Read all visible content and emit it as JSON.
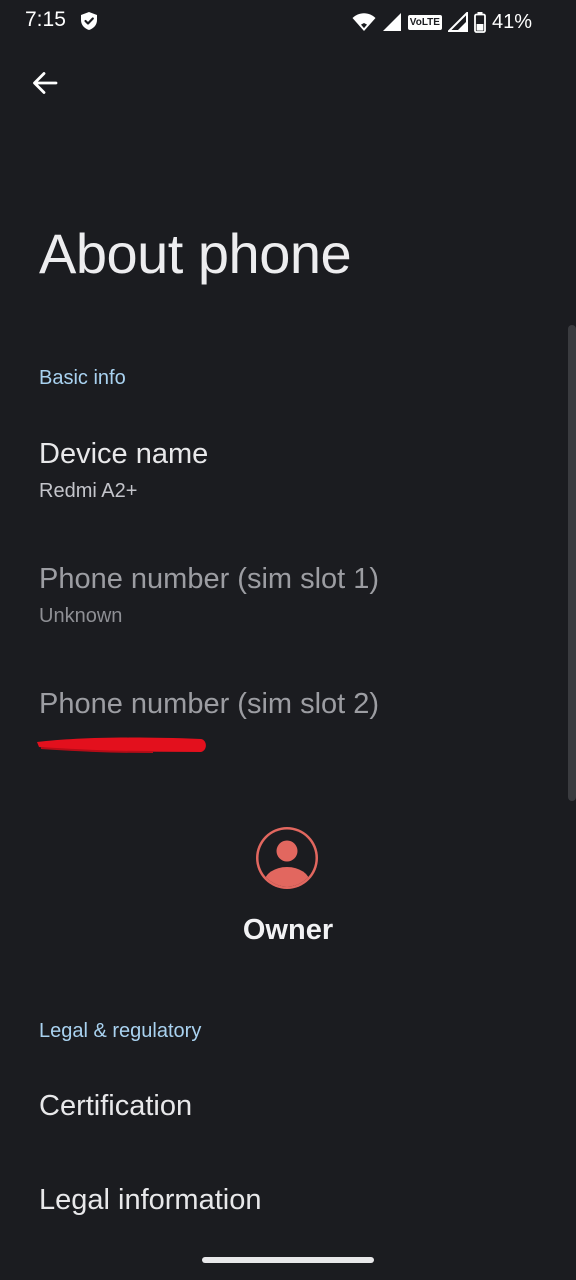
{
  "status_bar": {
    "time": "7:15",
    "network_label": "VoLTE",
    "battery_percent": "41%"
  },
  "header": {
    "title": "About phone"
  },
  "sections": {
    "basic_info": "Basic info",
    "legal": "Legal & regulatory"
  },
  "items": {
    "device_name": {
      "title": "Device name",
      "summary": "Redmi A2+"
    },
    "phone_sim1": {
      "title": "Phone number (sim slot 1)",
      "summary": "Unknown"
    },
    "phone_sim2": {
      "title": "Phone number (sim slot 2)",
      "summary": ""
    },
    "certification": {
      "title": "Certification"
    },
    "legal_information": {
      "title": "Legal information"
    }
  },
  "owner": {
    "label": "Owner"
  },
  "colors": {
    "background": "#1b1c20",
    "section_header": "#a9d2f0",
    "avatar": "#e2675f",
    "redaction": "#e3101d"
  },
  "icons": [
    "back-arrow-icon",
    "shield-icon",
    "wifi-icon",
    "signal-icon",
    "battery-icon",
    "account-circle-icon"
  ]
}
